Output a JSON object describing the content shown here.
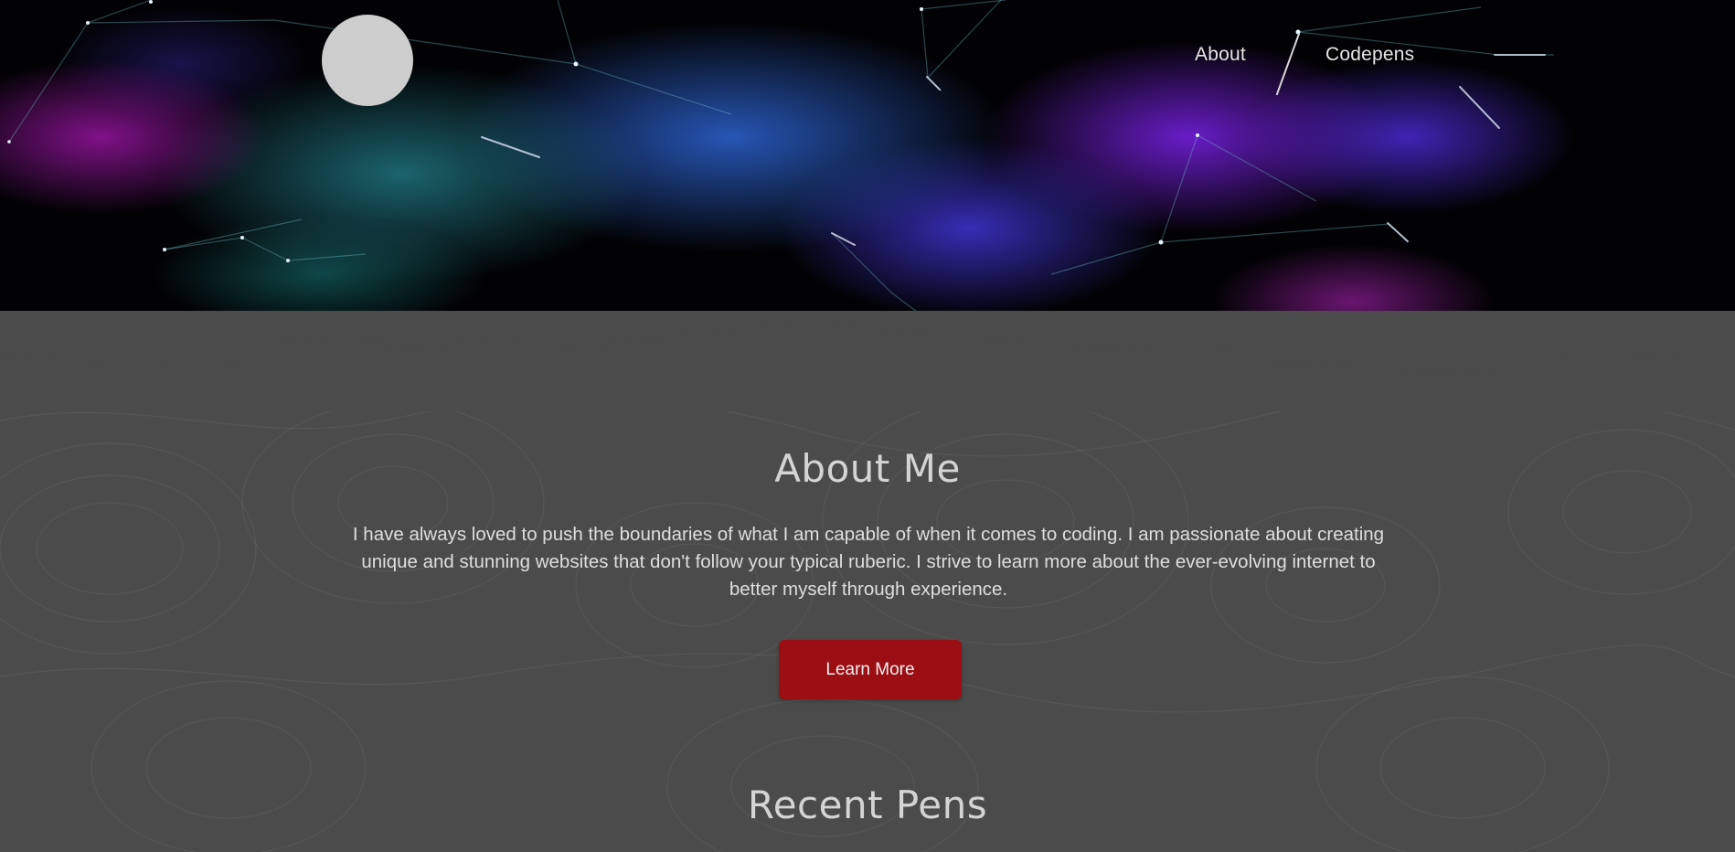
{
  "nav": {
    "logo_icon": "moon-icon",
    "items": [
      {
        "label": "About"
      },
      {
        "label": "Codepens"
      }
    ]
  },
  "about": {
    "title": "About Me",
    "text": "I have always loved to push the boundaries of what I am capable of when it comes to coding. I am passionate about creating unique and stunning websites that don't follow your typical ruberic. I strive to learn more about the ever-evolving internet to better myself through experience.",
    "button_label": "Learn More"
  },
  "recent_pens": {
    "title": "Recent Pens"
  },
  "colors": {
    "ground": "#4b4b4b",
    "accent_button": "#9b0f14",
    "moon": "#cdcdcd",
    "sky": "#020204"
  }
}
